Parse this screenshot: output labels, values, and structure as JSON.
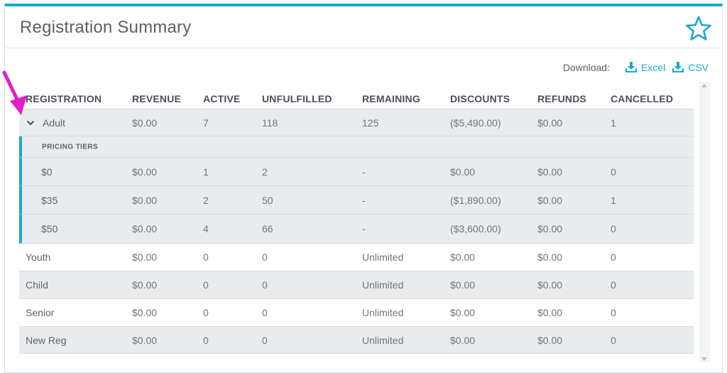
{
  "header": {
    "title": "Registration Summary",
    "favorite_icon": "star-icon"
  },
  "download": {
    "label": "Download:",
    "excel": "Excel",
    "csv": "CSV",
    "icon": "download-icon"
  },
  "colors": {
    "accent": "#1aa9cf",
    "pointer": "#e21fc7",
    "shaded_row": "#e9ecef"
  },
  "table": {
    "headers": [
      "REGISTRATION",
      "REVENUE",
      "ACTIVE",
      "UNFULFILLED",
      "REMAINING",
      "DISCOUNTS",
      "REFUNDS",
      "CANCELLED"
    ],
    "adult": {
      "name": "Adult",
      "revenue": "$0.00",
      "active": "7",
      "unfulfilled": "118",
      "remaining": "125",
      "discounts": "($5,490.00)",
      "refunds": "$0.00",
      "cancelled": "1"
    },
    "pricing_tiers_label": "PRICING TIERS",
    "tiers": [
      {
        "name": "$0",
        "revenue": "$0.00",
        "active": "1",
        "unfulfilled": "2",
        "remaining": "-",
        "discounts": "$0.00",
        "refunds": "$0.00",
        "cancelled": "0"
      },
      {
        "name": "$35",
        "revenue": "$0.00",
        "active": "2",
        "unfulfilled": "50",
        "remaining": "-",
        "discounts": "($1,890.00)",
        "refunds": "$0.00",
        "cancelled": "1"
      },
      {
        "name": "$50",
        "revenue": "$0.00",
        "active": "4",
        "unfulfilled": "66",
        "remaining": "-",
        "discounts": "($3,600.00)",
        "refunds": "$0.00",
        "cancelled": "0"
      }
    ],
    "rows": [
      {
        "name": "Youth",
        "revenue": "$0.00",
        "active": "0",
        "unfulfilled": "0",
        "remaining": "Unlimited",
        "discounts": "$0.00",
        "refunds": "$0.00",
        "cancelled": "0"
      },
      {
        "name": "Child",
        "revenue": "$0.00",
        "active": "0",
        "unfulfilled": "0",
        "remaining": "Unlimited",
        "discounts": "$0.00",
        "refunds": "$0.00",
        "cancelled": "0"
      },
      {
        "name": "Senior",
        "revenue": "$0.00",
        "active": "0",
        "unfulfilled": "0",
        "remaining": "Unlimited",
        "discounts": "$0.00",
        "refunds": "$0.00",
        "cancelled": "0"
      },
      {
        "name": "New Reg",
        "revenue": "$0.00",
        "active": "0",
        "unfulfilled": "0",
        "remaining": "Unlimited",
        "discounts": "$0.00",
        "refunds": "$0.00",
        "cancelled": "0"
      }
    ]
  }
}
